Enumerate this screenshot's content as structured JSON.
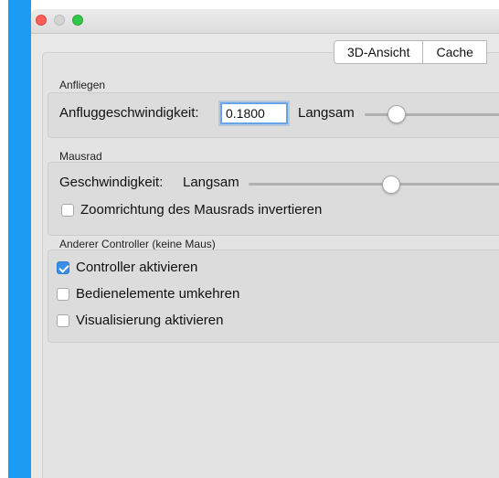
{
  "tabs": [
    "3D-Ansicht",
    "Cache"
  ],
  "approach": {
    "group_label": "Anfliegen",
    "speed_label": "Anfluggeschwindigkeit:",
    "speed_value": "0.1800",
    "slider_min_label": "Langsam",
    "slider_level_fraction": 0.25
  },
  "mousewheel": {
    "group_label": "Mausrad",
    "speed_label": "Geschwindigkeit:",
    "slider_min_label": "Langsam",
    "slider_level_fraction": 0.55,
    "invert_zoom_label": "Zoomrichtung des Mausrads invertieren",
    "invert_zoom_checked": false
  },
  "controller": {
    "group_label": "Anderer Controller (keine Maus)",
    "enable_label": "Controller aktivieren",
    "enable_checked": true,
    "reverse_label": "Bedienelemente umkehren",
    "reverse_checked": false,
    "visualize_label": "Visualisierung aktivieren",
    "visualize_checked": false
  },
  "colors": {
    "accent_bar": "#1d9bf0",
    "checkbox_checked": "#3a8ee6",
    "traffic_close": "#fc5f57",
    "traffic_max": "#34c749"
  }
}
